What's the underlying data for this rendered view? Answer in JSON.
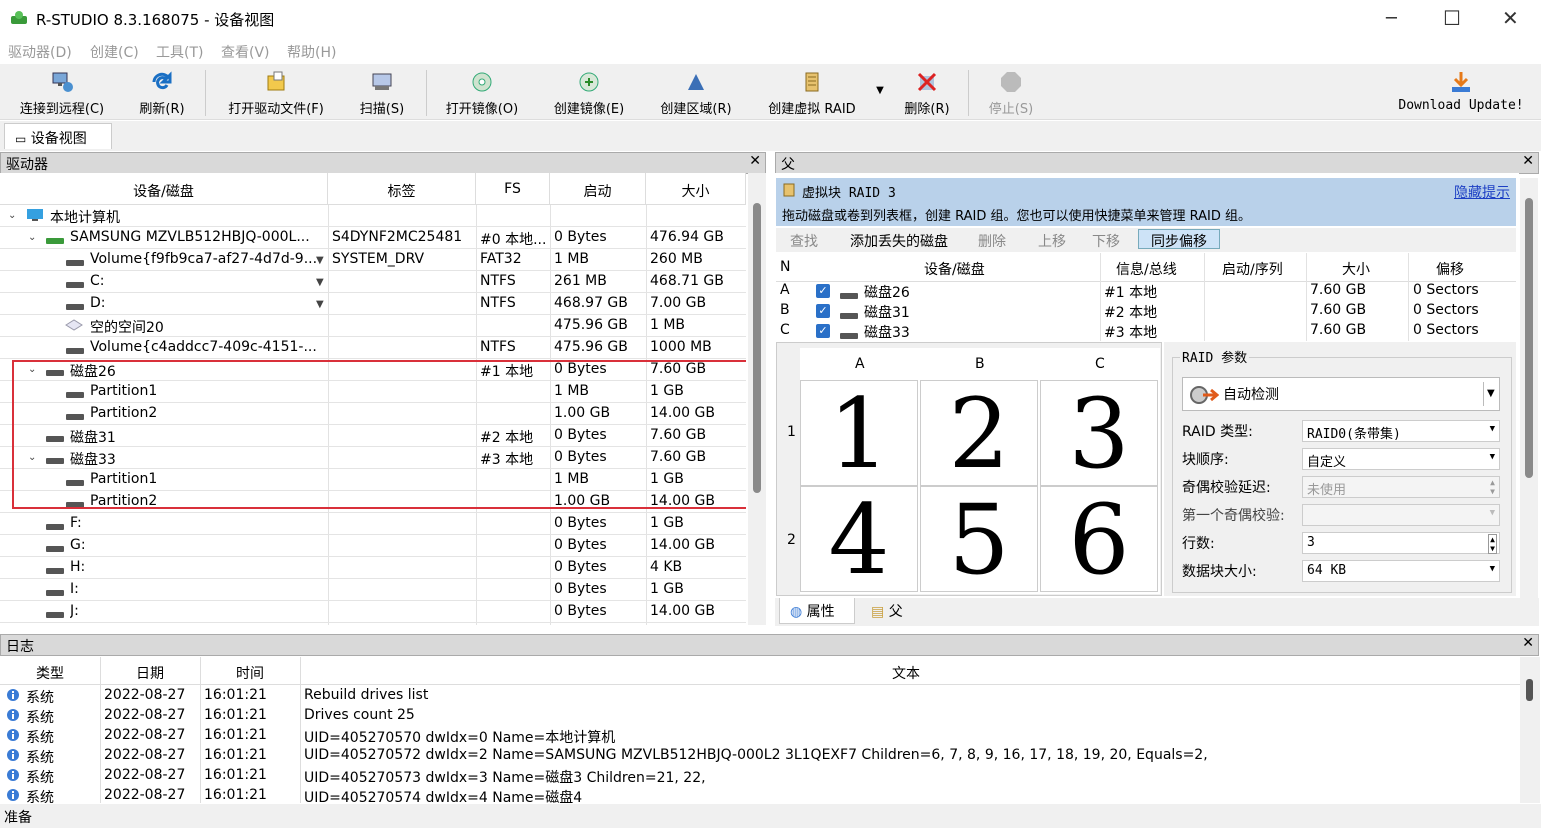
{
  "app": {
    "title": "R-STUDIO 8.3.168075 - 设备视图"
  },
  "menu": [
    "驱动器(D)",
    "创建(C)",
    "工具(T)",
    "查看(V)",
    "帮助(H)"
  ],
  "toolbar": {
    "connect": "连接到远程(C)",
    "refresh": "刷新(R)",
    "open_drive_file": "打开驱动文件(F)",
    "scan": "扫描(S)",
    "open_image": "打开镜像(O)",
    "create_image": "创建镜像(E)",
    "create_region": "创建区域(R)",
    "create_raid": "创建虚拟 RAID",
    "delete": "删除(R)",
    "stop": "停止(S)",
    "download": "Download Update!"
  },
  "tab": {
    "device_view": "设备视图"
  },
  "drives_panel": {
    "title": "驱动器",
    "columns": [
      "设备/磁盘",
      "标签",
      "FS",
      "启动",
      "大小"
    ],
    "rows": [
      {
        "name": "本地计算机",
        "label": "",
        "fs": "",
        "start": "",
        "size": ""
      },
      {
        "name": "SAMSUNG MZVLB512HBJQ-000L...",
        "label": "S4DYNF2MC25481",
        "fs": "#0 本地...",
        "start": "0 Bytes",
        "size": "476.94 GB"
      },
      {
        "name": "Volume{f9fb9ca7-af27-4d7d-9...",
        "label": "SYSTEM_DRV",
        "fs": "FAT32",
        "start": "1 MB",
        "size": "260 MB"
      },
      {
        "name": "C:",
        "label": "",
        "fs": "NTFS",
        "start": "261 MB",
        "size": "468.71 GB"
      },
      {
        "name": "D:",
        "label": "",
        "fs": "NTFS",
        "start": "468.97 GB",
        "size": "7.00 GB"
      },
      {
        "name": "空的空间20",
        "label": "",
        "fs": "",
        "start": "475.96 GB",
        "size": "1 MB"
      },
      {
        "name": "Volume{c4addcc7-409c-4151-...",
        "label": "",
        "fs": "NTFS",
        "start": "475.96 GB",
        "size": "1000 MB"
      },
      {
        "name": "磁盘26",
        "label": "",
        "fs": "#1 本地",
        "start": "0 Bytes",
        "size": "7.60 GB"
      },
      {
        "name": "Partition1",
        "label": "",
        "fs": "",
        "start": "1 MB",
        "size": "1 GB"
      },
      {
        "name": "Partition2",
        "label": "",
        "fs": "",
        "start": "1.00 GB",
        "size": "14.00 GB"
      },
      {
        "name": "磁盘31",
        "label": "",
        "fs": "#2 本地",
        "start": "0 Bytes",
        "size": "7.60 GB"
      },
      {
        "name": "磁盘33",
        "label": "",
        "fs": "#3 本地",
        "start": "0 Bytes",
        "size": "7.60 GB"
      },
      {
        "name": "Partition1",
        "label": "",
        "fs": "",
        "start": "1 MB",
        "size": "1 GB"
      },
      {
        "name": "Partition2",
        "label": "",
        "fs": "",
        "start": "1.00 GB",
        "size": "14.00 GB"
      },
      {
        "name": "F:",
        "label": "",
        "fs": "",
        "start": "0 Bytes",
        "size": "1 GB"
      },
      {
        "name": "G:",
        "label": "",
        "fs": "",
        "start": "0 Bytes",
        "size": "14.00 GB"
      },
      {
        "name": "H:",
        "label": "",
        "fs": "",
        "start": "0 Bytes",
        "size": "4 KB"
      },
      {
        "name": "I:",
        "label": "",
        "fs": "",
        "start": "0 Bytes",
        "size": "1 GB"
      },
      {
        "name": "J:",
        "label": "",
        "fs": "",
        "start": "0 Bytes",
        "size": "14.00 GB"
      }
    ]
  },
  "parent_panel": {
    "title": "父",
    "hint_title": "虚拟块 RAID 3",
    "hint_text": "拖动磁盘或卷到列表框，创建 RAID 组。您也可以使用快捷菜单来管理 RAID 组。",
    "hide_hint": "隐藏提示",
    "buttons": [
      "查找",
      "添加丢失的磁盘",
      "删除",
      "上移",
      "下移",
      "同步偏移"
    ],
    "columns": [
      "N",
      "设备/磁盘",
      "信息/总线",
      "启动/序列",
      "大小",
      "偏移"
    ],
    "members": [
      {
        "n": "A",
        "name": "磁盘26",
        "info": "#1 本地",
        "seq": "",
        "size": "7.60 GB",
        "offset": "0 Sectors"
      },
      {
        "n": "B",
        "name": "磁盘31",
        "info": "#2 本地",
        "seq": "",
        "size": "7.60 GB",
        "offset": "0 Sectors"
      },
      {
        "n": "C",
        "name": "磁盘33",
        "info": "#3 本地",
        "seq": "",
        "size": "7.60 GB",
        "offset": "0 Sectors"
      }
    ],
    "grid_cols": [
      "A",
      "B",
      "C"
    ],
    "grid_rows": [
      "1",
      "2"
    ],
    "grid_values": [
      "1",
      "2",
      "3",
      "4",
      "5",
      "6"
    ],
    "params_title": "RAID 参数",
    "auto_detect": "自动检测",
    "params": [
      {
        "label": "RAID 类型:",
        "value": "RAID0(条带集)"
      },
      {
        "label": "块顺序:",
        "value": "自定义"
      },
      {
        "label": "奇偶校验延迟:",
        "value": "未使用"
      },
      {
        "label": "第一个奇偶校验:",
        "value": ""
      },
      {
        "label": "行数:",
        "value": "3"
      },
      {
        "label": "数据块大小:",
        "value": "64 KB"
      }
    ],
    "tabs": [
      "属性",
      "父"
    ]
  },
  "log_panel": {
    "title": "日志",
    "columns": [
      "类型",
      "日期",
      "时间",
      "文本"
    ],
    "rows": [
      {
        "type": "系统",
        "date": "2022-08-27",
        "time": "16:01:21",
        "text": "Rebuild drives list"
      },
      {
        "type": "系统",
        "date": "2022-08-27",
        "time": "16:01:21",
        "text": "Drives count 25"
      },
      {
        "type": "系统",
        "date": "2022-08-27",
        "time": "16:01:21",
        "text": "UID=405270570 dwIdx=0 Name=本地计算机"
      },
      {
        "type": "系统",
        "date": "2022-08-27",
        "time": "16:01:21",
        "text": "UID=405270572 dwIdx=2 Name=SAMSUNG MZVLB512HBJQ-000L2 3L1QEXF7  Children=6, 7, 8, 9, 16, 17, 18, 19, 20,   Equals=2,"
      },
      {
        "type": "系统",
        "date": "2022-08-27",
        "time": "16:01:21",
        "text": "UID=405270573 dwIdx=3 Name=磁盘3  Children=21, 22,"
      },
      {
        "type": "系统",
        "date": "2022-08-27",
        "time": "16:01:21",
        "text": "UID=405270574 dwIdx=4 Name=磁盘4"
      }
    ]
  },
  "status": "准备"
}
